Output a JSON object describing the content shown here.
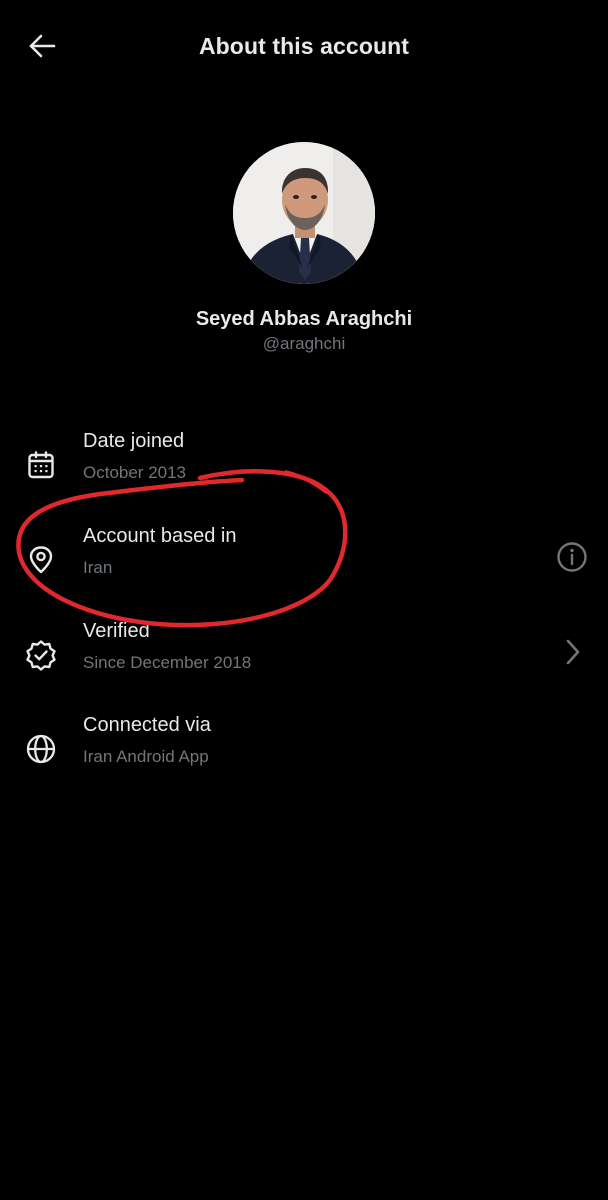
{
  "header": {
    "title": "About this account",
    "back_icon": "arrow-left-icon"
  },
  "profile": {
    "display_name": "Seyed Abbas Araghchi",
    "handle": "@araghchi"
  },
  "rows": [
    {
      "label": "Date joined",
      "value": "October 2013",
      "icon": "calendar-icon"
    },
    {
      "label": "Account based in",
      "value": "Iran",
      "icon": "location-pin-icon",
      "trailing_icon": "info-icon"
    },
    {
      "label": "Verified",
      "value": "Since December 2018",
      "icon": "verified-badge-icon",
      "trailing_icon": "chevron-right-icon"
    },
    {
      "label": "Connected via",
      "value": "Iran Android App",
      "icon": "globe-icon"
    }
  ],
  "colors": {
    "background": "#000000",
    "primary_text": "#e7e9ea",
    "secondary_text": "#71767b",
    "annotation": "#e0282f"
  }
}
